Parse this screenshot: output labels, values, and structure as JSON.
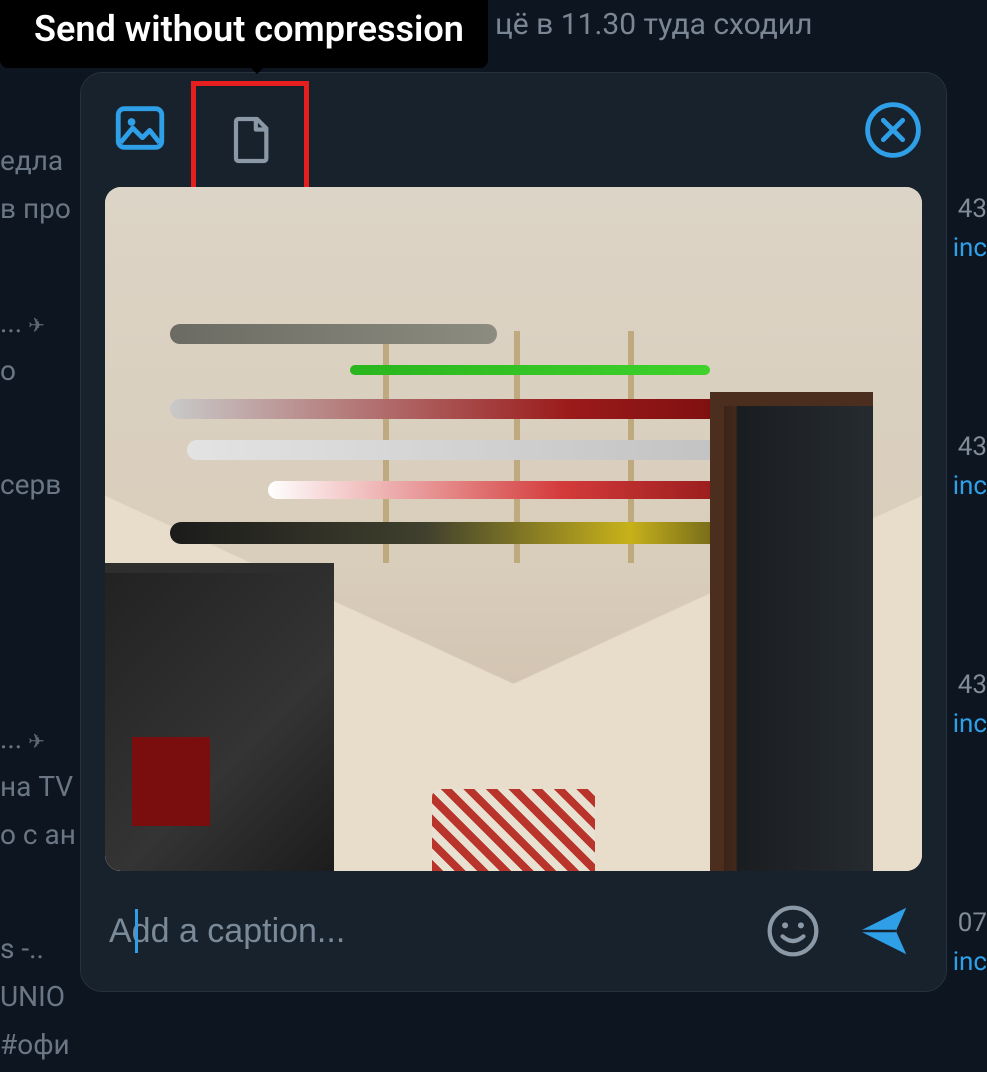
{
  "tooltip": {
    "label": "Send without compression"
  },
  "background": {
    "top_line": "цё в 11.30 туда сходил",
    "left_lines": [
      "едла",
      "в про",
      "",
      "",
      "",
      "серв",
      "",
      "",
      "",
      "",
      "",
      "на TV",
      "о с ан",
      "",
      "s -..",
      "UNIO",
      "#офи"
    ],
    "left_dots": "...",
    "right_times": [
      "43",
      "inc",
      "43",
      "inc",
      "43",
      "inc",
      "07",
      "inc"
    ]
  },
  "modal": {
    "modes": {
      "photo": "photo",
      "file": "file"
    },
    "close": "close",
    "preview_alt": "Room photo with skis mounted on wall",
    "caption_placeholder": "Add a caption...",
    "emoji": "emoji",
    "send": "send"
  },
  "colors": {
    "accent": "#2f9fe8",
    "highlight_box": "#e61e1e",
    "panel_bg": "#18222d"
  }
}
